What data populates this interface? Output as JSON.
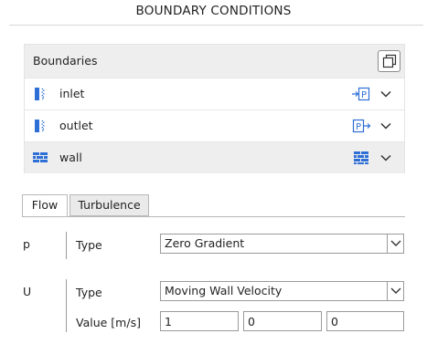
{
  "header": {
    "title": "BOUNDARY CONDITIONS"
  },
  "boundaries": {
    "label": "Boundaries",
    "copy_icon": "copy-icon",
    "items": [
      {
        "label": "inlet",
        "icon": "patch-icon",
        "type_icon": "patch-type-icon",
        "type_letter": "P",
        "selected": false
      },
      {
        "label": "outlet",
        "icon": "patch-icon",
        "type_icon": "patch-type-icon",
        "type_letter": "P",
        "selected": false
      },
      {
        "label": "wall",
        "icon": "wall-icon",
        "type_icon": "wall-type-icon",
        "type_letter": "",
        "selected": true
      }
    ]
  },
  "tabs": [
    {
      "label": "Flow",
      "active": true
    },
    {
      "label": "Turbulence",
      "active": false
    }
  ],
  "fields": {
    "p": {
      "letter": "p",
      "type_label": "Type",
      "type_value": "Zero Gradient"
    },
    "U": {
      "letter": "U",
      "type_label": "Type",
      "type_value": "Moving Wall Velocity",
      "value_label": "Value [m/s]",
      "values": [
        "1",
        "0",
        "0"
      ]
    }
  },
  "colors": {
    "accent_blue": "#2e6fd6",
    "header_bg": "#eeeeee",
    "selected_row_bg": "#eeeeee"
  }
}
